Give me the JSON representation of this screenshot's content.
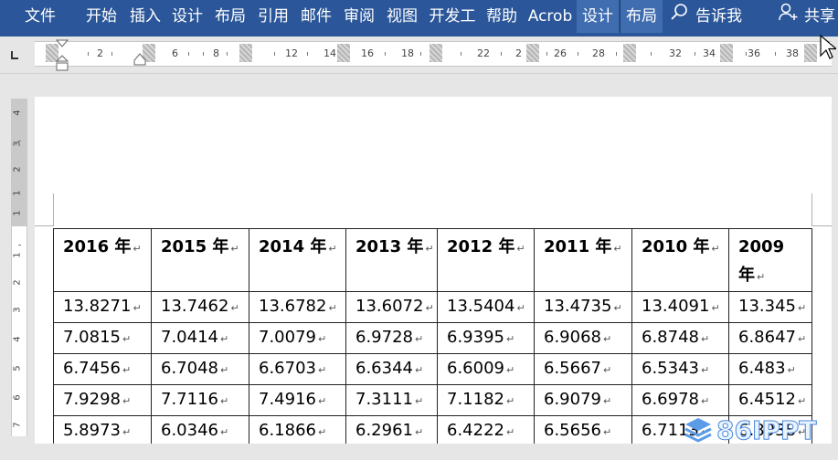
{
  "ribbon": {
    "tabs": [
      "文件",
      "开始",
      "插入",
      "设计",
      "布局",
      "引用",
      "邮件",
      "审阅",
      "视图",
      "开发工",
      "帮助",
      "Acrob",
      "设计",
      "布局"
    ],
    "tell_me": "告诉我",
    "share": "共享",
    "colors": {
      "background": "#2b579a",
      "contextual": "#3f6db0"
    }
  },
  "ruler": {
    "numbers": [
      "2",
      "6",
      "8",
      "12",
      "14",
      "16",
      "18",
      "22",
      "2",
      "26",
      "28",
      "32",
      "34",
      "36",
      "38"
    ]
  },
  "vertical_ruler": {
    "numbers": [
      "4",
      "3",
      "2",
      "1",
      "1",
      "1",
      "2",
      "3",
      "4",
      "5",
      "6",
      "7"
    ]
  },
  "table": {
    "headers": [
      "2016 年",
      "2015 年",
      "2014 年",
      "2013 年",
      "2012 年",
      "2011 年",
      "2010 年",
      "2009 年"
    ],
    "rows": [
      [
        "13.8271",
        "13.7462",
        "13.6782",
        "13.6072",
        "13.5404",
        "13.4735",
        "13.4091",
        "13.345"
      ],
      [
        "7.0815",
        "7.0414",
        "7.0079",
        "6.9728",
        "6.9395",
        "6.9068",
        "6.8748",
        "6.8647"
      ],
      [
        "6.7456",
        "6.7048",
        "6.6703",
        "6.6344",
        "6.6009",
        "6.5667",
        "6.5343",
        "6.483"
      ],
      [
        "7.9298",
        "7.7116",
        "7.4916",
        "7.3111",
        "7.1182",
        "6.9079",
        "6.6978",
        "6.4512"
      ],
      [
        "5.8973",
        "6.0346",
        "6.1866",
        "6.2961",
        "6.4222",
        "6.5656",
        "6.7113",
        "6.8938"
      ]
    ],
    "paragraph_mark": "↵"
  },
  "watermark": {
    "text": "86IPPT"
  }
}
